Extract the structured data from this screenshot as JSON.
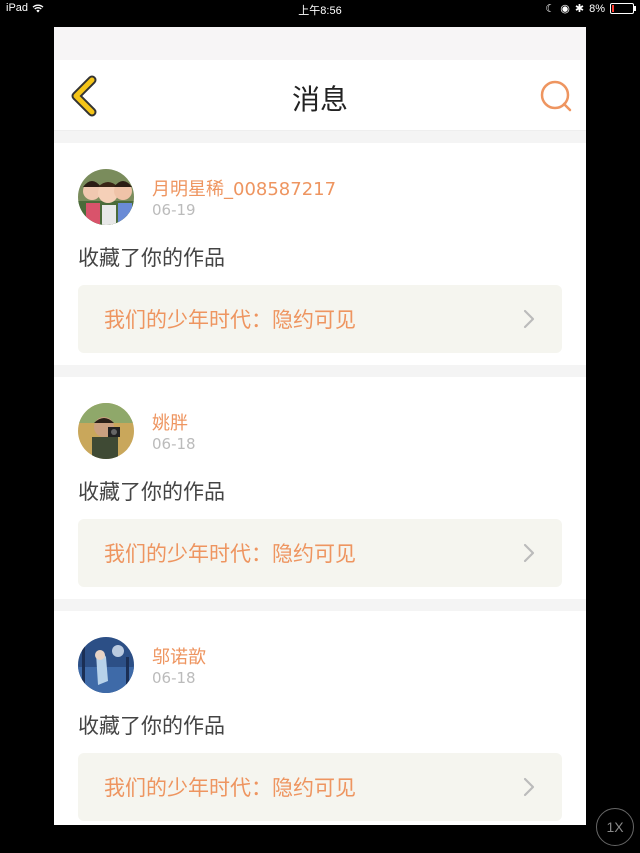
{
  "status_bar": {
    "device": "iPad",
    "time": "上午8:56",
    "battery": "8%"
  },
  "nav": {
    "title": "消息",
    "back_icon": "chevron-left-icon",
    "search_icon": "search-icon"
  },
  "messages": [
    {
      "username": "月明星稀_008587217",
      "date": "06-19",
      "action": "收藏了你的作品",
      "work_title": "我们的少年时代：隐约可见"
    },
    {
      "username": "姚胖",
      "date": "06-18",
      "action": "收藏了你的作品",
      "work_title": "我们的少年时代：隐约可见"
    },
    {
      "username": "邬诺歆",
      "date": "06-18",
      "action": "收藏了你的作品",
      "work_title": "我们的少年时代：隐约可见"
    }
  ],
  "zoom": "1X",
  "colors": {
    "accent": "#ee9560",
    "back_arrow": "#f5c518",
    "card_link_bg": "#f5f5ef"
  }
}
